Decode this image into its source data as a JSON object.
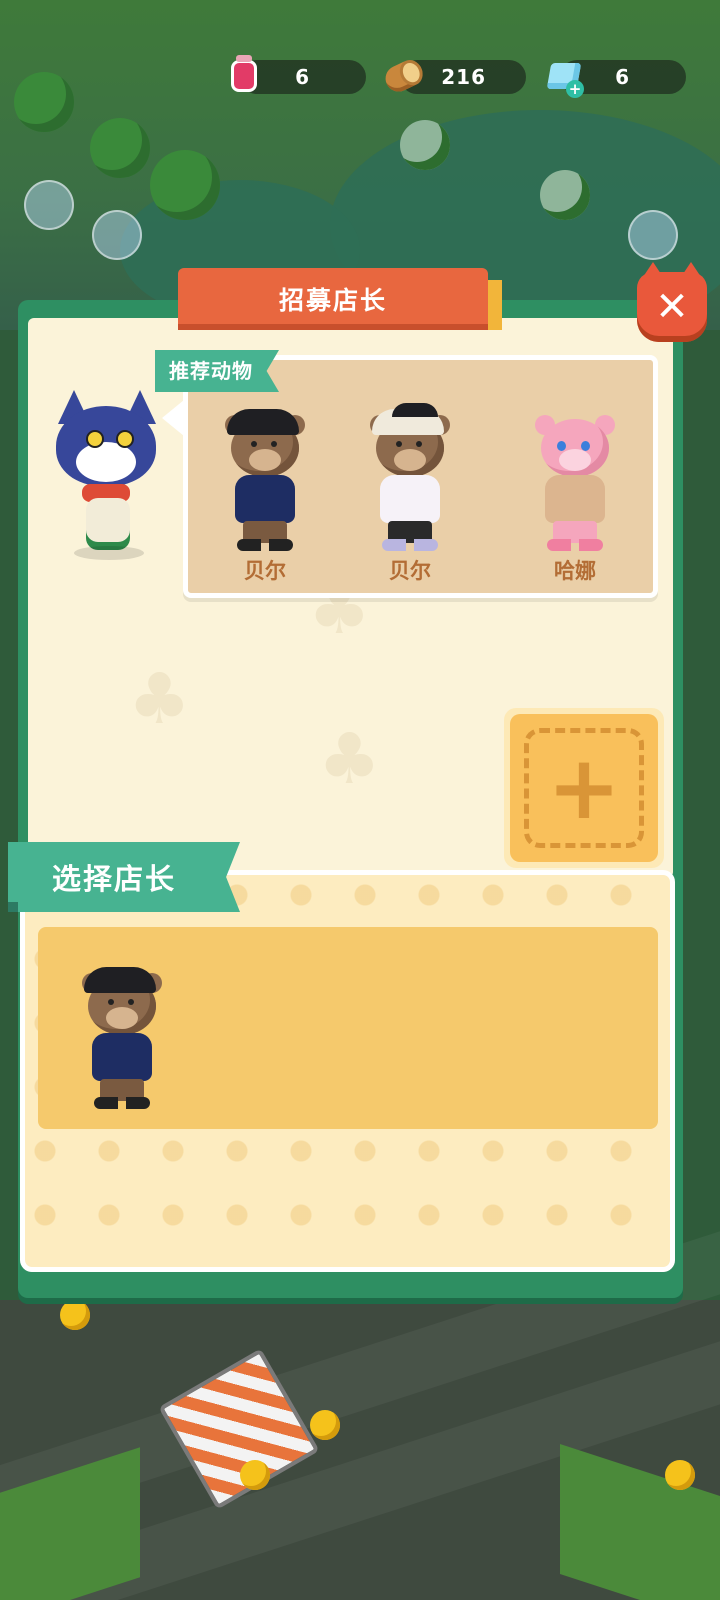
{
  "resources": [
    {
      "id": "potion",
      "icon": "potion-jar-icon",
      "value": "6"
    },
    {
      "id": "wood",
      "icon": "wood-log-icon",
      "value": "216"
    },
    {
      "id": "gem",
      "icon": "gem-icon",
      "value": "6",
      "has_plus": true
    }
  ],
  "dialog": {
    "title": "招募店长",
    "close_icon": "close-icon",
    "recommended": {
      "tag": "推荐动物",
      "animals": [
        {
          "name": "贝尔",
          "kind": "bear",
          "outfit": "navy-hoodie"
        },
        {
          "name": "贝尔",
          "kind": "bear",
          "outfit": "white-hoodie"
        },
        {
          "name": "哈娜",
          "kind": "pink-bear",
          "outfit": "beige-cape"
        }
      ]
    },
    "add_slot_icon": "plus-icon",
    "select": {
      "tag": "选择店长",
      "candidates": [
        {
          "kind": "bear",
          "outfit": "navy-hoodie"
        }
      ]
    }
  },
  "colors": {
    "accent_orange": "#e8673f",
    "panel_green": "#2e8f62",
    "tag_green": "#47b391",
    "label_brown": "#b36d35"
  }
}
